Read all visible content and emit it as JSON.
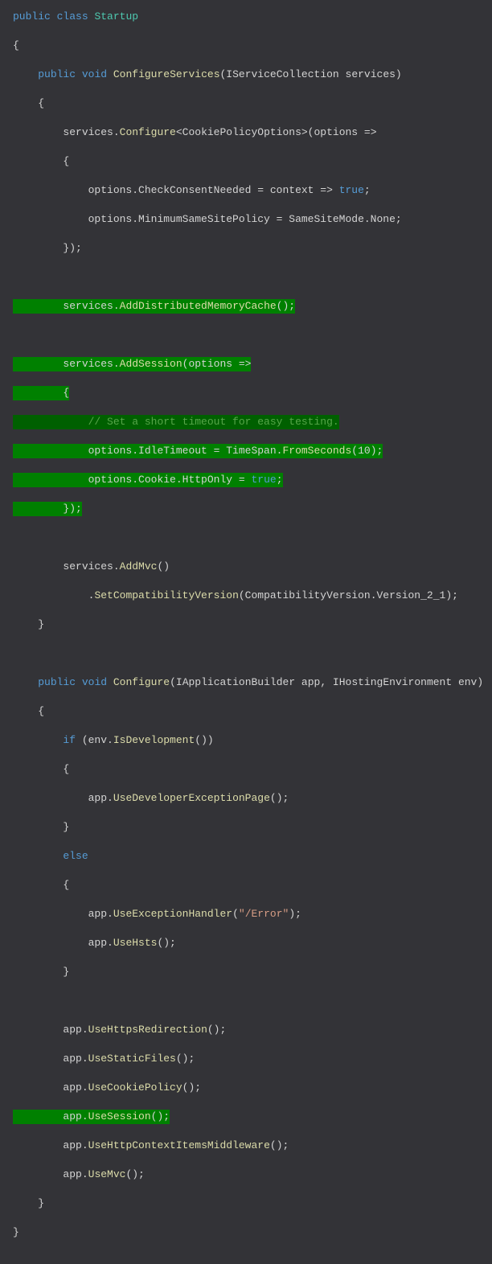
{
  "code": {
    "l1_kw1": "public",
    "l1_kw2": "class",
    "l1_type": "Startup",
    "l2": "{",
    "l3_kw1": "public",
    "l3_kw2": "void",
    "l3_method": "ConfigureServices",
    "l3_rest": "(IServiceCollection services)",
    "l4": "{",
    "l5a": "services.",
    "l5m": "Configure",
    "l5b": "<CookiePolicyOptions>(options =>",
    "l6": "{",
    "l7a": "options.CheckConsentNeeded = context => ",
    "l7kw": "true",
    "l7b": ";",
    "l8": "options.MinimumSameSitePolicy = SameSiteMode.None;",
    "l9": "});",
    "l11a": "services.",
    "l11m": "AddDistributedMemoryCache",
    "l11b": "();",
    "l13a": "services.",
    "l13m": "AddSession",
    "l13b": "(options =>",
    "l14": "{",
    "l15": "// Set a short timeout for easy testing.",
    "l16a": "options.IdleTimeout = TimeSpan.",
    "l16m": "FromSeconds",
    "l16b": "(10);",
    "l17a": "options.Cookie.HttpOnly = ",
    "l17kw": "true",
    "l17b": ";",
    "l18": "});",
    "l20a": "services.",
    "l20m": "AddMvc",
    "l20b": "()",
    "l21a": ".",
    "l21m": "SetCompatibilityVersion",
    "l21b": "(CompatibilityVersion.Version_2_1);",
    "l22": "}",
    "l24_kw1": "public",
    "l24_kw2": "void",
    "l24_method": "Configure",
    "l24_rest": "(IApplicationBuilder app, IHostingEnvironment env)",
    "l25": "{",
    "l26kw": "if",
    "l26a": " (env.",
    "l26m": "IsDevelopment",
    "l26b": "())",
    "l27": "{",
    "l28a": "app.",
    "l28m": "UseDeveloperExceptionPage",
    "l28b": "();",
    "l29": "}",
    "l30": "else",
    "l31": "{",
    "l32a": "app.",
    "l32m": "UseExceptionHandler",
    "l32b": "(",
    "l32str": "\"/Error\"",
    "l32c": ");",
    "l33a": "app.",
    "l33m": "UseHsts",
    "l33b": "();",
    "l34": "}",
    "l36a": "app.",
    "l36m": "UseHttpsRedirection",
    "l36b": "();",
    "l37a": "app.",
    "l37m": "UseStaticFiles",
    "l37b": "();",
    "l38a": "app.",
    "l38m": "UseCookiePolicy",
    "l38b": "();",
    "l39a": "app.",
    "l39m": "UseSession",
    "l39b": "();",
    "l40a": "app.",
    "l40m": "UseHttpContextItemsMiddleware",
    "l40b": "();",
    "l41a": "app.",
    "l41m": "UseMvc",
    "l41b": "();",
    "l42": "}",
    "l43": "}"
  }
}
